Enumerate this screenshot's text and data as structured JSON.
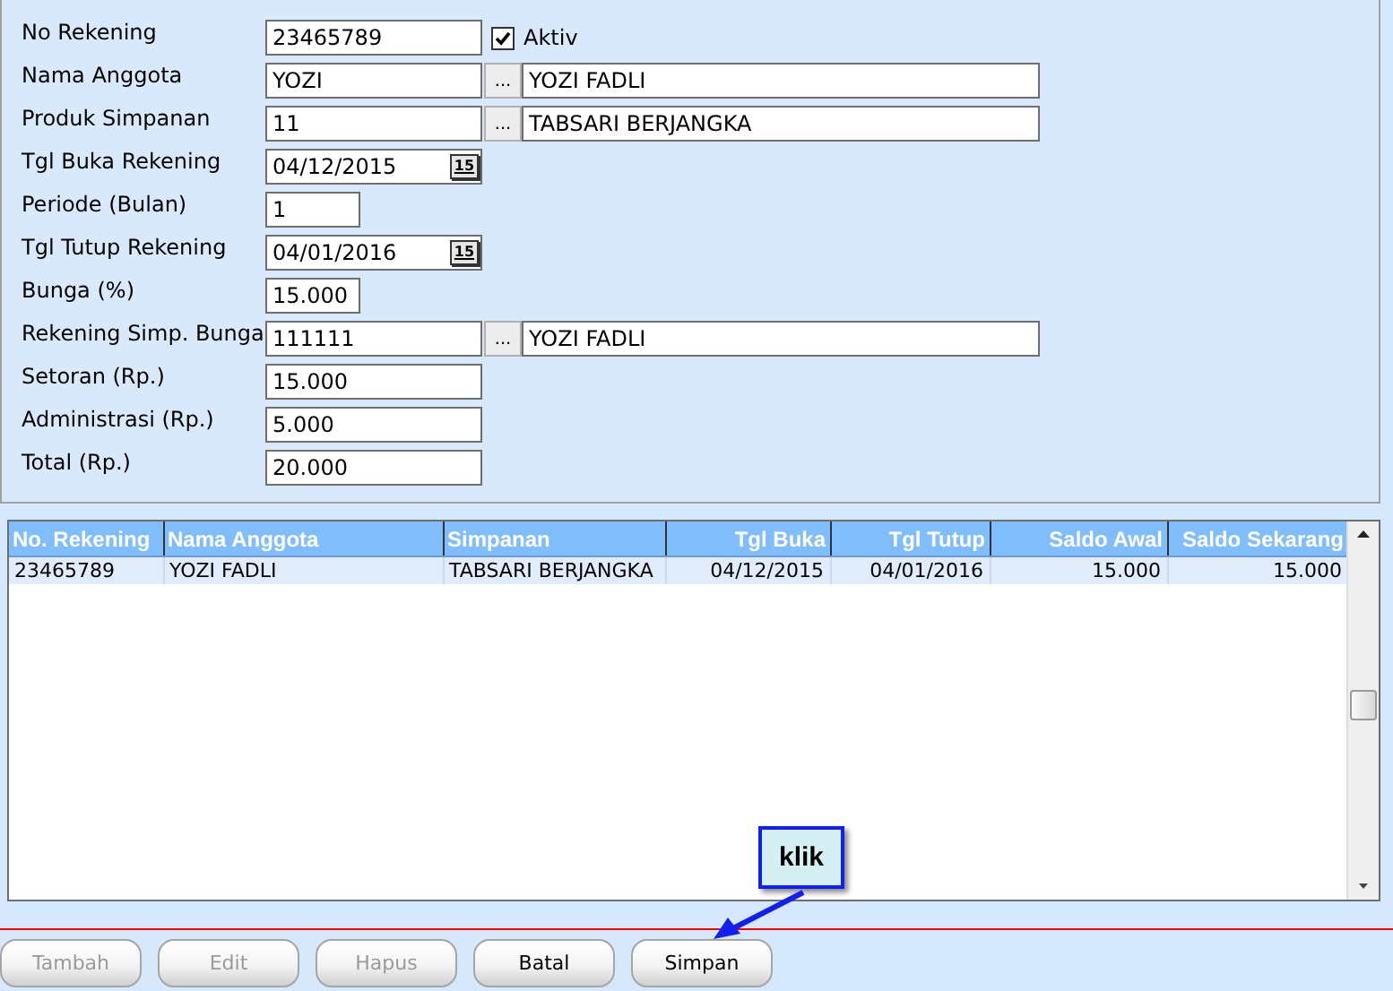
{
  "form": {
    "rows": [
      {
        "kind": "text",
        "label": "No Rekening",
        "value": "23465789",
        "checkbox": {
          "label": "Aktiv",
          "checked": true
        }
      },
      {
        "kind": "lookup",
        "label": "Nama Anggota",
        "value": "YOZI",
        "button": "...",
        "name": "YOZI FADLI"
      },
      {
        "kind": "lookup",
        "label": "Produk Simpanan",
        "value": "11",
        "button": "...",
        "name": "TABSARI BERJANGKA"
      },
      {
        "kind": "date",
        "label": "Tgl Buka Rekening",
        "value": "04/12/2015",
        "button": "15"
      },
      {
        "kind": "short",
        "label": "Periode (Bulan)",
        "value": "1"
      },
      {
        "kind": "date",
        "label": "Tgl Tutup Rekening",
        "value": "04/01/2016",
        "button": "15"
      },
      {
        "kind": "short",
        "label": "Bunga (%)",
        "value": "15.000"
      },
      {
        "kind": "lookup",
        "label": "Rekening Simp. Bunga",
        "value": "111111",
        "button": "...",
        "name": "YOZI FADLI"
      },
      {
        "kind": "text",
        "label": "Setoran (Rp.)",
        "value": "15.000"
      },
      {
        "kind": "text",
        "label": "Administrasi (Rp.)",
        "value": "5.000"
      },
      {
        "kind": "text",
        "label": "Total (Rp.)",
        "value": "20.000"
      }
    ]
  },
  "table": {
    "columns": [
      "No. Rekening",
      "Nama Anggota",
      "Simpanan",
      "Tgl Buka",
      "Tgl Tutup",
      "Saldo Awal",
      "Saldo Sekarang"
    ],
    "rows": [
      {
        "selected": true,
        "cells": [
          "23465789",
          "YOZI FADLI",
          "TABSARI BERJANGKA",
          "04/12/2015",
          "04/01/2016",
          "15.000",
          "15.000"
        ]
      }
    ]
  },
  "buttons": [
    {
      "label": "Tambah",
      "disabled": true
    },
    {
      "label": "Edit",
      "disabled": true
    },
    {
      "label": "Hapus",
      "disabled": true
    },
    {
      "label": "Batal",
      "disabled": false
    },
    {
      "label": "Simpan",
      "disabled": false
    }
  ],
  "callout": {
    "text": "klik"
  }
}
